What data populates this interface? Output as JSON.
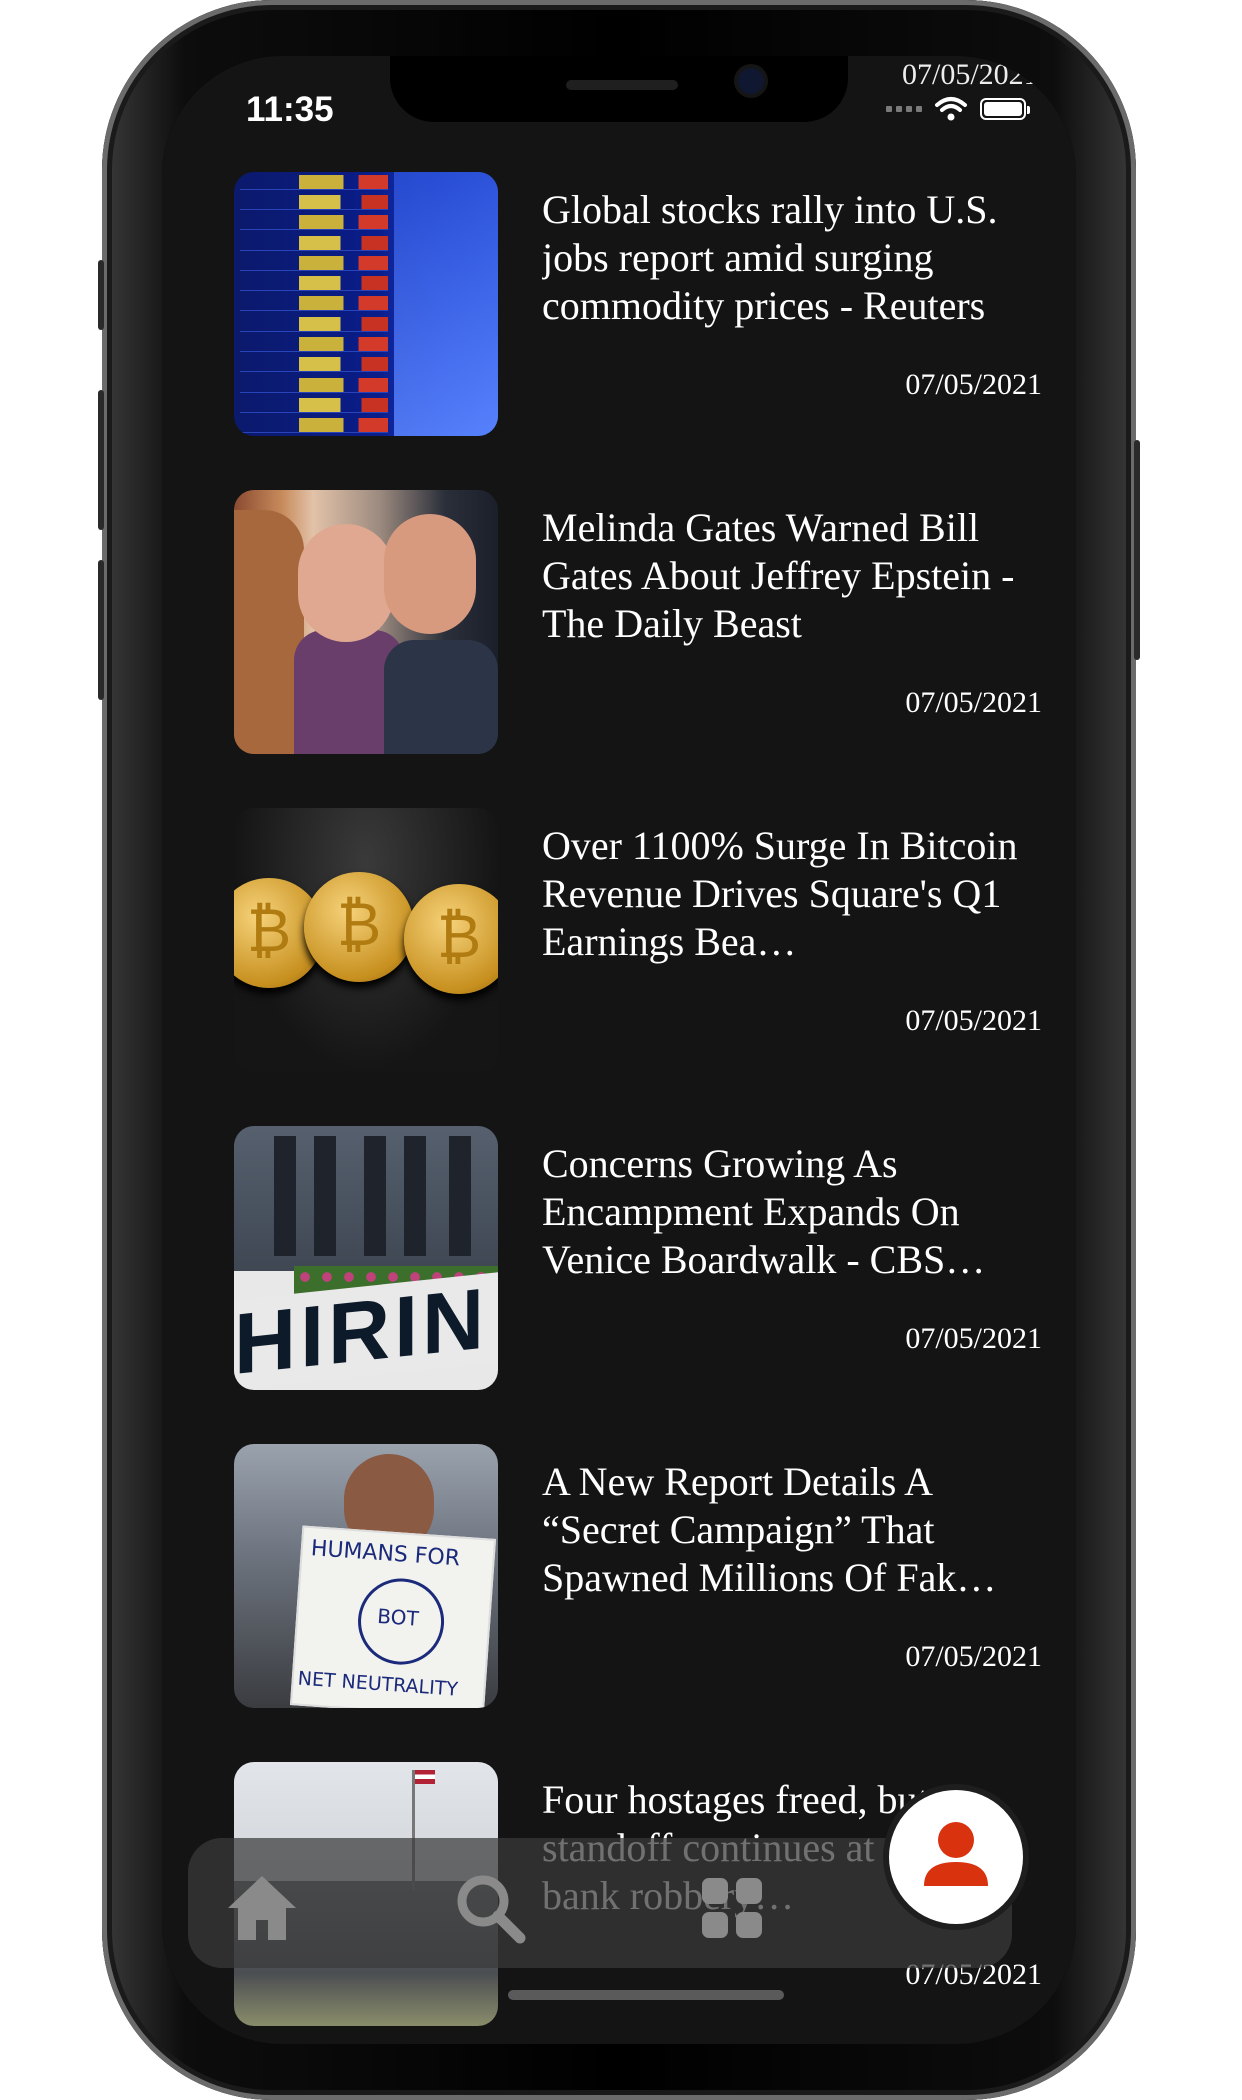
{
  "status_bar": {
    "time": "11:35",
    "top_date": "07/05/2021",
    "icons": [
      "signal-icon",
      "wifi-icon",
      "battery-icon"
    ]
  },
  "articles": [
    {
      "title": "Global stocks rally into U.S. jobs report amid surging commodity prices - Reuters",
      "date": "07/05/2021",
      "image": "stock-board-image"
    },
    {
      "title": "Melinda Gates Warned Bill Gates About Jeffrey Epstein - The Daily Beast",
      "date": "07/05/2021",
      "image": "people-portrait-image"
    },
    {
      "title": "Over 1100% Surge In Bitcoin Revenue Drives Square's Q1 Earnings Bea…",
      "date": "07/05/2021",
      "image": "bitcoin-coins-image"
    },
    {
      "title": "Concerns Growing As Encampment Expands On Venice Boardwalk - CBS…",
      "date": "07/05/2021",
      "image": "hiring-sign-building-image"
    },
    {
      "title": "A New Report Details A “Secret Campaign” That Spawned Millions Of Fak…",
      "date": "07/05/2021",
      "image": "protest-sign-image"
    },
    {
      "title": "Four hostages freed, but standoff continues at Cloud bank robbery…",
      "date": "07/05/2021",
      "image": "bank-building-image"
    }
  ],
  "thumbnail_text": {
    "hiring": "HIRIN",
    "sign_top": "HUMANS FOR",
    "sign_bottom": "NET NEUTRALITY",
    "sign_mid": "BOT"
  },
  "bottom_nav": {
    "items": [
      "home-icon",
      "search-icon",
      "grid-icon"
    ],
    "profile": "profile-icon"
  },
  "colors": {
    "background": "#141414",
    "text": "#ffffff",
    "accent": "#d8320f",
    "nav_bg": "#3a3a3a"
  }
}
